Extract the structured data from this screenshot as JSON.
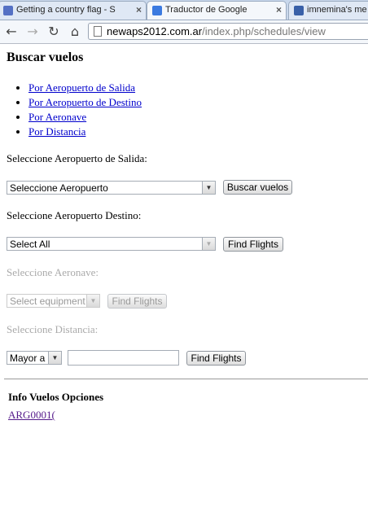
{
  "browser": {
    "tabs": [
      {
        "title": "Getting a country flag - S",
        "active": false,
        "favicon_color": "#5470c4"
      },
      {
        "title": "Traductor de Google",
        "active": true,
        "favicon_color": "#3b7ae0"
      },
      {
        "title": "imnemina's me",
        "active": false,
        "favicon_color": "#3960a8"
      }
    ],
    "tab_close_glyph": "×",
    "url_domain": "newaps2012.com.ar",
    "url_path": "/index.php/schedules/view"
  },
  "page": {
    "title": "Buscar vuelos",
    "options": [
      "Por Aeropuerto de Salida",
      "Por Aeropuerto de Destino",
      "Por Aeronave",
      "Por Distancia"
    ],
    "departure": {
      "label": "Seleccione Aeropuerto de Salida:",
      "select_value": "Seleccione Aeropuerto",
      "button": "Buscar vuelos"
    },
    "destination": {
      "label": "Seleccione Aeropuerto Destino:",
      "select_value": "Select All",
      "button": "Find Flights"
    },
    "aircraft": {
      "label": "Seleccione Aeronave:",
      "select_value": "Select equipment",
      "button": "Find Flights"
    },
    "distance": {
      "label": "Seleccione Distancia:",
      "select_value": "Mayor a",
      "input_value": "",
      "button": "Find Flights"
    },
    "info": {
      "title": "Info Vuelos Opciones",
      "link": "ARG0001("
    }
  }
}
